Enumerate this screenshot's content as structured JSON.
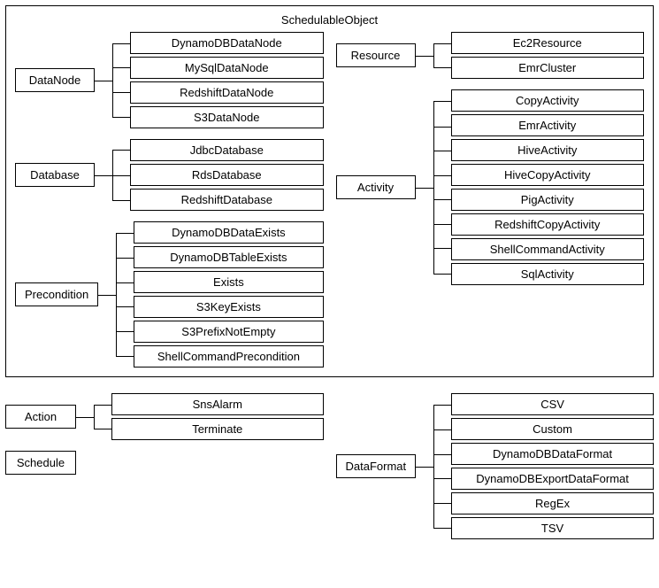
{
  "schedulable": {
    "title": "SchedulableObject",
    "dataNode": {
      "label": "DataNode",
      "children": [
        "DynamoDBDataNode",
        "MySqlDataNode",
        "RedshiftDataNode",
        "S3DataNode"
      ]
    },
    "database": {
      "label": "Database",
      "children": [
        "JdbcDatabase",
        "RdsDatabase",
        "RedshiftDatabase"
      ]
    },
    "precondition": {
      "label": "Precondition",
      "children": [
        "DynamoDBDataExists",
        "DynamoDBTableExists",
        "Exists",
        "S3KeyExists",
        "S3PrefixNotEmpty",
        "ShellCommandPrecondition"
      ]
    },
    "resource": {
      "label": "Resource",
      "children": [
        "Ec2Resource",
        "EmrCluster"
      ]
    },
    "activity": {
      "label": "Activity",
      "children": [
        "CopyActivity",
        "EmrActivity",
        "HiveActivity",
        "HiveCopyActivity",
        "PigActivity",
        "RedshiftCopyActivity",
        "ShellCommandActivity",
        "SqlActivity"
      ]
    }
  },
  "action": {
    "label": "Action",
    "children": [
      "SnsAlarm",
      "Terminate"
    ]
  },
  "schedule": {
    "label": "Schedule"
  },
  "dataFormat": {
    "label": "DataFormat",
    "children": [
      "CSV",
      "Custom",
      "DynamoDBDataFormat",
      "DynamoDBExportDataFormat",
      "RegEx",
      "TSV"
    ]
  }
}
